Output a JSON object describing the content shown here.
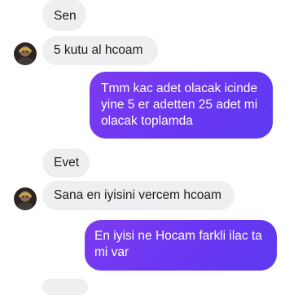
{
  "messages": [
    {
      "from": "them",
      "text": "Sen"
    },
    {
      "from": "them",
      "text": "5 kutu al hcoam",
      "avatar": true
    },
    {
      "from": "me",
      "text": "Tmm kac adet olacak icinde yine 5 er adetten 25 adet mi olacak toplamda"
    },
    {
      "from": "them",
      "text": "Evet"
    },
    {
      "from": "them",
      "text": "Sana en iyisini vercem hcoam",
      "avatar": true
    },
    {
      "from": "me",
      "text": "En iyisi ne Hocam farkli ilac ta mi var"
    }
  ],
  "colors": {
    "incoming_bubble": "#efeff1",
    "outgoing_bubble_start": "#7c3cf0",
    "outgoing_bubble_end": "#5b3af0"
  },
  "icons": {
    "avatar": "contact-avatar"
  }
}
